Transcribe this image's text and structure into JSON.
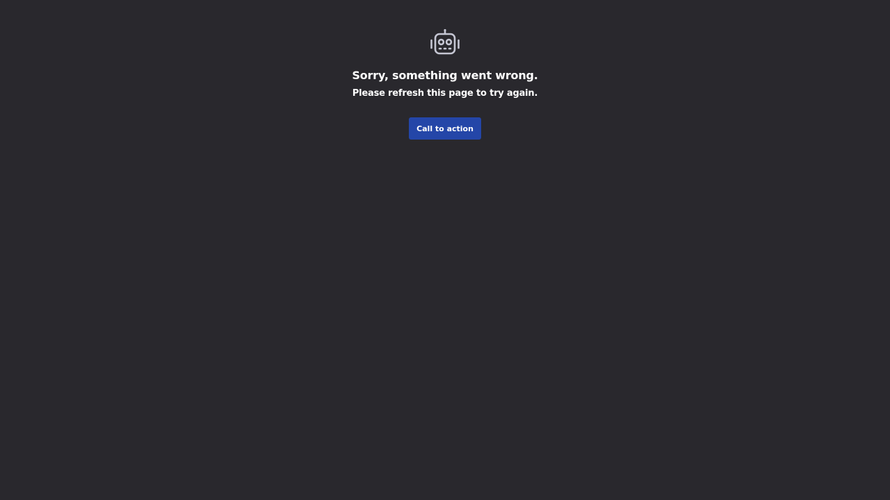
{
  "error": {
    "icon": "robot-icon",
    "title": "Sorry, something went wrong.",
    "message": "Please refresh this page to try again.",
    "button_label": "Call to action"
  },
  "colors": {
    "background": "#29282d",
    "text": "#ffffff",
    "icon": "#c5c6d3",
    "button": "#2446a8"
  }
}
